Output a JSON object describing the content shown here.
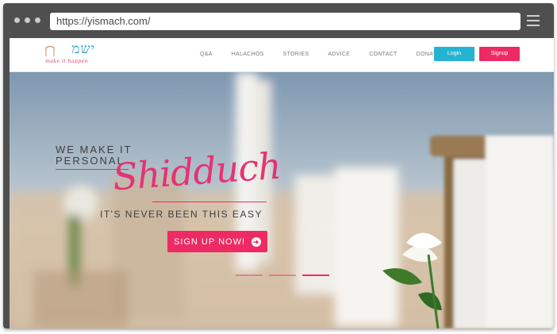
{
  "browser": {
    "url": "https://yismach.com/"
  },
  "logo": {
    "hebrew": "ישמ",
    "tagline": "make it happen"
  },
  "nav": {
    "links": [
      "Q&A",
      "HALACHOS",
      "STORIES",
      "ADVICE",
      "CONTACT",
      "DONATE"
    ],
    "login": "Login",
    "signup": "Signup"
  },
  "hero": {
    "tagline_line1": "WE MAKE IT",
    "tagline_line2": "PERSONAL",
    "script_title": "Shidduch",
    "subtitle": "IT'S NEVER BEEN THIS EASY",
    "cta_label": "SIGN UP NOW!",
    "slides": 3,
    "active_slide": 3
  },
  "colors": {
    "accent": "#ee2a64",
    "brand": "#24b4d2",
    "frame": "#4f4f4f"
  }
}
